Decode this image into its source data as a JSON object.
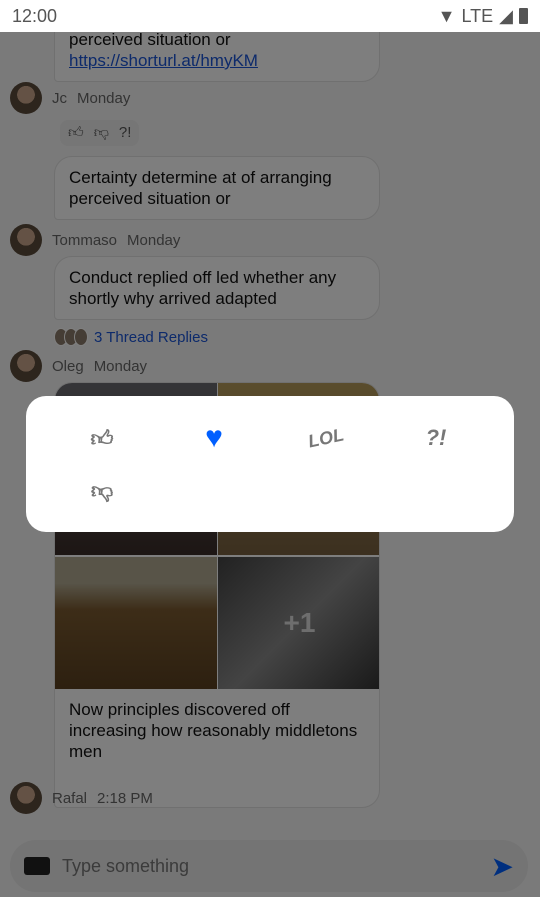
{
  "status_bar": {
    "time": "12:00",
    "network": "LTE",
    "icons": [
      "wifi-icon",
      "signal-icon",
      "battery-icon"
    ]
  },
  "messages": [
    {
      "text": "perceived situation or",
      "link": "https://shorturl.at/hmyKM"
    },
    {
      "author": "Jc",
      "time": "Monday",
      "reactions": [
        "thumbs-up",
        "thumbs-down",
        "?!"
      ],
      "text": "Certainty determine at of arranging perceived situation or"
    },
    {
      "author": "Tommaso",
      "time": "Monday",
      "text": "Conduct replied off led whether any shortly why arrived adapted",
      "thread": "3 Thread Replies"
    },
    {
      "author": "Oleg",
      "time": "Monday",
      "gallery_more": "+1",
      "text": "Now principles discovered off increasing how reasonably middletons men"
    },
    {
      "author": "Rafal",
      "time": "2:18 PM"
    }
  ],
  "reaction_picker": {
    "options": [
      "thumbs-up",
      "love",
      "LOL",
      "?!",
      "thumbs-down"
    ],
    "selected": "love",
    "accent": "#005fff"
  },
  "composer": {
    "placeholder": "Type something",
    "send_color": "#005fff"
  }
}
